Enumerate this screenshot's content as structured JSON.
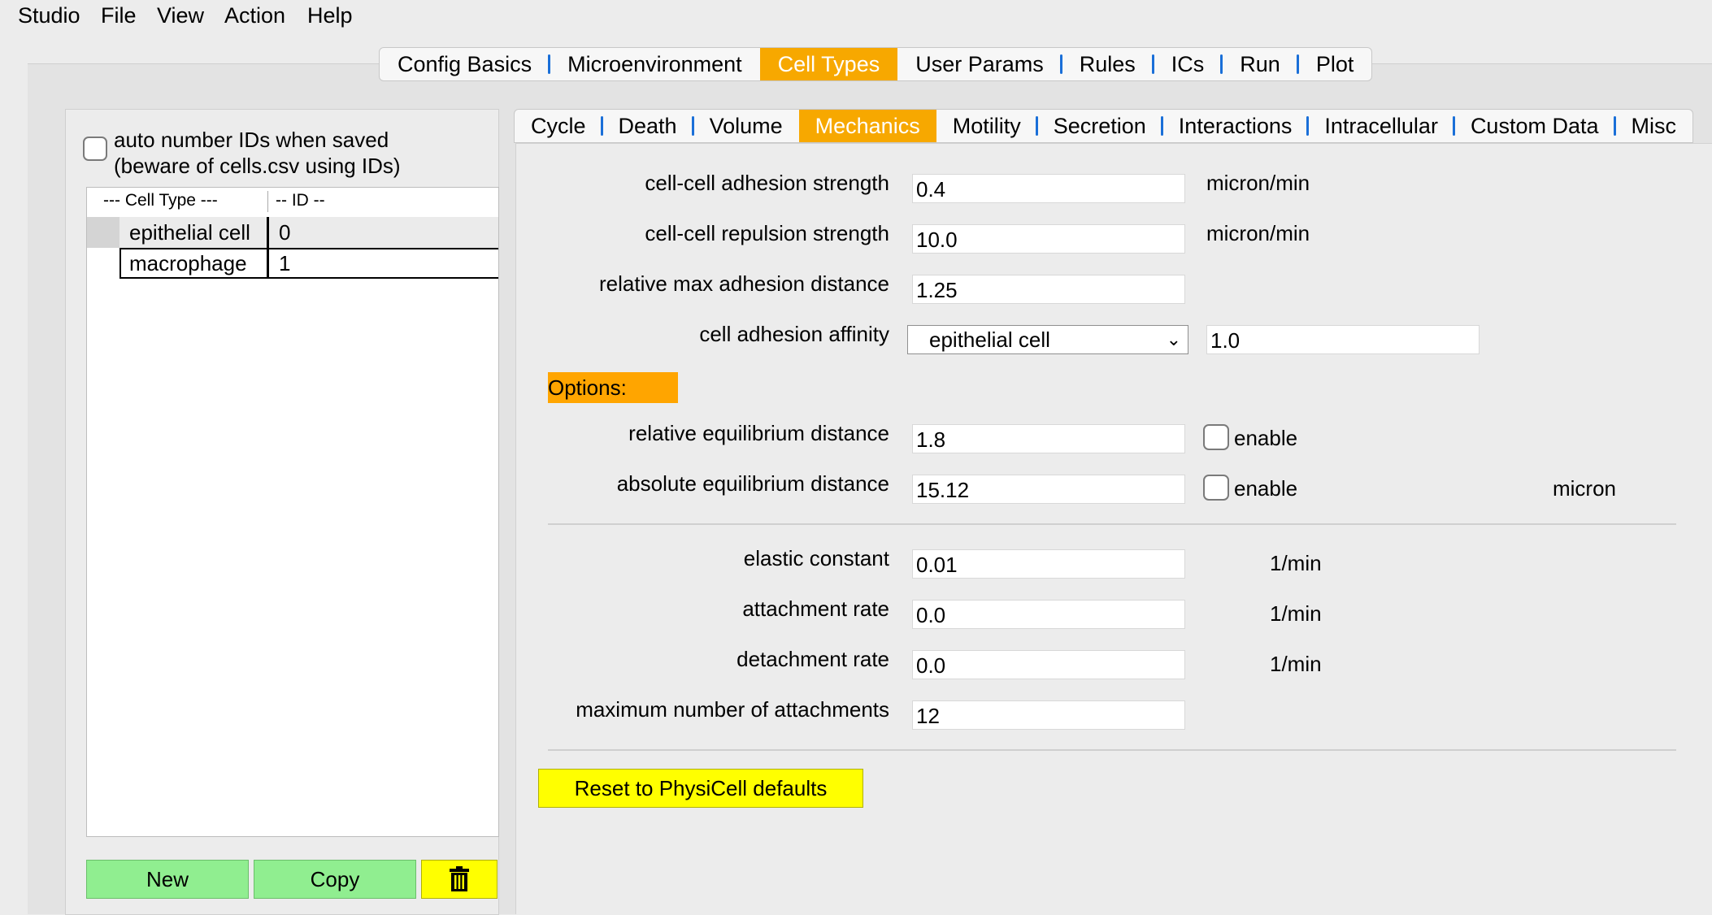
{
  "menubar": [
    "Studio",
    "File",
    "View",
    "Action",
    "Help"
  ],
  "main_tabs": [
    "Config Basics",
    "Microenvironment",
    "Cell Types",
    "User Params",
    "Rules",
    "ICs",
    "Run",
    "Plot"
  ],
  "main_tab_active": "Cell Types",
  "left": {
    "auto_number_line1": "auto number IDs when saved",
    "auto_number_line2": "(beware of cells.csv using IDs)",
    "col_cell_type": "---  Cell Type ---",
    "col_id": "-- ID --",
    "rows": [
      {
        "name": "epithelial cell",
        "id": "0"
      },
      {
        "name": "macrophage",
        "id": "1"
      }
    ],
    "new_label": "New",
    "copy_label": "Copy",
    "delete_icon": "trash-icon"
  },
  "sub_tabs": [
    "Cycle",
    "Death",
    "Volume",
    "Mechanics",
    "Motility",
    "Secretion",
    "Interactions",
    "Intracellular",
    "Custom Data",
    "Misc"
  ],
  "sub_tab_active": "Mechanics",
  "mechanics": {
    "adhesion_label": "cell-cell adhesion strength",
    "adhesion_value": "0.4",
    "adhesion_unit": "micron/min",
    "repulsion_label": "cell-cell repulsion strength",
    "repulsion_value": "10.0",
    "repulsion_unit": "micron/min",
    "max_adh_label": "relative max adhesion distance",
    "max_adh_value": "1.25",
    "affinity_label": "cell adhesion affinity",
    "affinity_select": "epithelial cell",
    "affinity_value": "1.0",
    "options_label": "Options:",
    "rel_eq_label": "relative equilibrium distance",
    "rel_eq_value": "1.8",
    "enable_label": "enable",
    "abs_eq_label": "absolute equilibrium distance",
    "abs_eq_value": "15.12",
    "abs_eq_unit": "micron",
    "elastic_label": "elastic constant",
    "elastic_value": "0.01",
    "elastic_unit": "1/min",
    "attach_label": "attachment rate",
    "attach_value": "0.0",
    "attach_unit": "1/min",
    "detach_label": "detachment rate",
    "detach_value": "0.0",
    "detach_unit": "1/min",
    "max_attach_label": "maximum number of attachments",
    "max_attach_value": "12",
    "reset_label": "Reset to PhysiCell defaults"
  },
  "colors": {
    "active_tab": "#f7a800",
    "tab_separator": "#1a6fd8",
    "green_button": "#90ee90",
    "yellow_button": "#ffff00",
    "options_badge": "#ffa500"
  }
}
